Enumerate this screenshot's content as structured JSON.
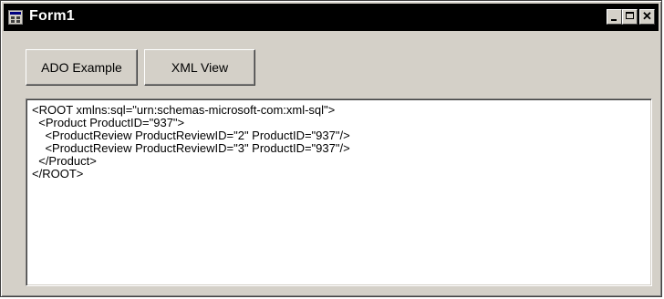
{
  "window": {
    "title": "Form1",
    "controls": {
      "minimize_icon": "minimize-icon",
      "maximize_icon": "maximize-icon",
      "close_icon": "close-icon"
    },
    "colors": {
      "titlebar": "#000000",
      "face": "#d4d0c8"
    }
  },
  "buttons": {
    "ado_label": "ADO Example",
    "xml_label": "XML View"
  },
  "textbox": {
    "lines": [
      "<ROOT xmlns:sql=\"urn:schemas-microsoft-com:xml-sql\">",
      "  <Product ProductID=\"937\">",
      "    <ProductReview ProductReviewID=\"2\" ProductID=\"937\"/>",
      "    <ProductReview ProductReviewID=\"3\" ProductID=\"937\"/>",
      "  </Product>",
      "</ROOT>"
    ]
  }
}
